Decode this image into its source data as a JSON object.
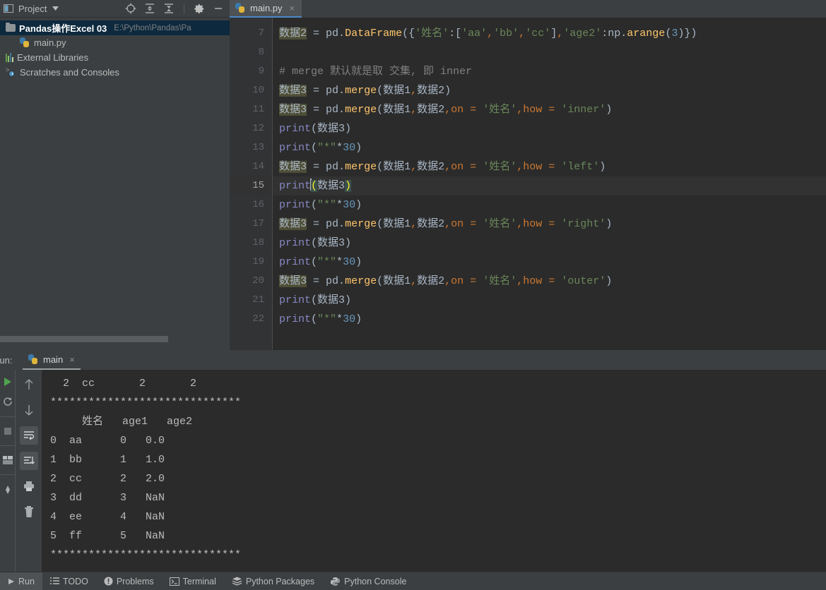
{
  "project_panel": {
    "title": "Project",
    "dropdown_icon": "chevron-down-icon",
    "tools": [
      {
        "name": "locate-icon",
        "label": "Select Opened File"
      },
      {
        "name": "expand-all-icon",
        "label": "Expand All"
      },
      {
        "name": "collapse-all-icon",
        "label": "Collapse All"
      },
      {
        "name": "gear-icon",
        "label": "Settings"
      },
      {
        "name": "minimize-icon",
        "label": "Hide"
      }
    ],
    "tree": [
      {
        "icon": "folder-icon",
        "name": "Pandas操作Excel 03",
        "path": "E:\\Python\\Pandas\\Pa",
        "selected": true,
        "indent": 0
      },
      {
        "icon": "python-file-icon",
        "name": "main.py",
        "path": "",
        "selected": false,
        "indent": 1
      },
      {
        "icon": "external-libraries-icon",
        "name": "External Libraries",
        "path": "",
        "selected": false,
        "indent": 0
      },
      {
        "icon": "scratches-icon",
        "name": "Scratches and Consoles",
        "path": "",
        "selected": false,
        "indent": 0
      }
    ]
  },
  "editor": {
    "tab": {
      "icon": "python-file-icon",
      "label": "main.py",
      "close": "×"
    },
    "lines": [
      {
        "num": "7",
        "current": false
      },
      {
        "num": "8",
        "current": false
      },
      {
        "num": "9",
        "current": false
      },
      {
        "num": "10",
        "current": false
      },
      {
        "num": "11",
        "current": false
      },
      {
        "num": "12",
        "current": false
      },
      {
        "num": "13",
        "current": false
      },
      {
        "num": "14",
        "current": false
      },
      {
        "num": "15",
        "current": true
      },
      {
        "num": "16",
        "current": false
      },
      {
        "num": "17",
        "current": false
      },
      {
        "num": "18",
        "current": false
      },
      {
        "num": "19",
        "current": false
      },
      {
        "num": "20",
        "current": false
      },
      {
        "num": "21",
        "current": false
      },
      {
        "num": "22",
        "current": false
      }
    ],
    "code": [
      "数据2 = pd.DataFrame({'姓名':['aa','bb','cc'],'age2':np.arange(3)})",
      "",
      "# merge 默认就是取 交集, 即 inner",
      "数据3 = pd.merge(数据1,数据2)",
      "数据3 = pd.merge(数据1,数据2,on = '姓名',how = 'inner')",
      "print(数据3)",
      "print(\"*\"*30)",
      "数据3 = pd.merge(数据1,数据2,on = '姓名',how = 'left')",
      "print(数据3)",
      "print(\"*\"*30)",
      "数据3 = pd.merge(数据1,数据2,on = '姓名',how = 'right')",
      "print(数据3)",
      "print(\"*\"*30)",
      "数据3 = pd.merge(数据1,数据2,on = '姓名',how = 'outer')",
      "print(数据3)",
      "print(\"*\"*30)"
    ]
  },
  "run_panel": {
    "label": "Run:",
    "tab": {
      "icon": "python-file-icon",
      "label": "main",
      "close": "×"
    },
    "left_strip_icons": [
      {
        "name": "run-icon"
      },
      {
        "name": "rerun-icon"
      },
      {
        "name": "stop-icon"
      },
      {
        "name": "layout-icon"
      },
      {
        "name": "pin-icon"
      }
    ],
    "toolbar_icons": [
      {
        "name": "arrow-up-icon",
        "active": false
      },
      {
        "name": "arrow-down-icon",
        "active": false
      },
      {
        "name": "soft-wrap-icon",
        "active": true
      },
      {
        "name": "scroll-to-end-icon",
        "active": true
      },
      {
        "name": "print-icon",
        "active": false
      },
      {
        "name": "trash-icon",
        "active": false
      }
    ],
    "console_lines": [
      "  2  cc       2       2",
      "******************************",
      "     姓名   age1   age2",
      "0  aa      0   0.0",
      "1  bb      1   1.0",
      "2  cc      2   2.0",
      "3  dd      3   NaN",
      "4  ee      4   NaN",
      "5  ff      5   NaN",
      "******************************"
    ]
  },
  "statusbar": {
    "items": [
      {
        "icon": "run-arrow-icon",
        "label": "Run",
        "active": true
      },
      {
        "icon": "todo-icon",
        "label": "TODO",
        "active": false
      },
      {
        "icon": "problems-icon",
        "label": "Problems",
        "active": false
      },
      {
        "icon": "terminal-icon",
        "label": "Terminal",
        "active": false
      },
      {
        "icon": "python-packages-icon",
        "label": "Python Packages",
        "active": false
      },
      {
        "icon": "python-console-icon",
        "label": "Python Console",
        "active": false
      }
    ]
  },
  "colors": {
    "panel_bg": "#3c3f41",
    "editor_bg": "#2b2b2b",
    "gutter_bg": "#313335",
    "selection_blue": "#0d293e",
    "tab_underline": "#4a88c7",
    "keyword_orange": "#cc7832",
    "string_green": "#6a8759",
    "number_blue": "#6897bb",
    "function_yellow": "#ffc66d",
    "identifier_highlight": "#4e4e36",
    "bracket_match": "#3b514d",
    "text_default": "#a9b7c6"
  }
}
